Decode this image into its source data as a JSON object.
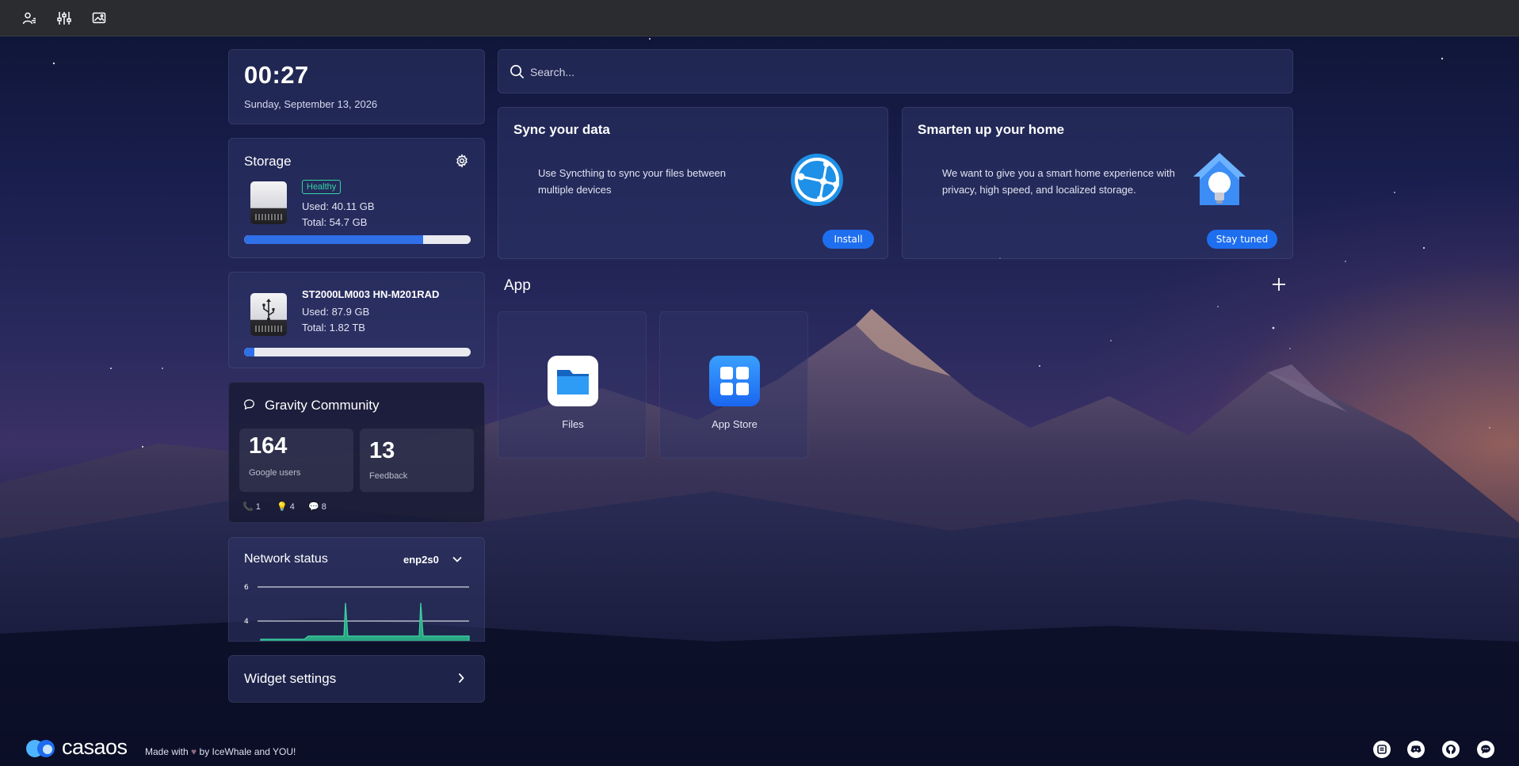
{
  "topbar": {
    "icons": [
      "account-settings-icon",
      "controls-sliders-icon",
      "wallpaper-icon"
    ]
  },
  "clock": {
    "time": "00:27",
    "date": "Sunday, September 13, 2026"
  },
  "storage": {
    "title": "Storage",
    "status": "Healthy",
    "used": "Used: 40.11 GB",
    "total": "Total: 54.7 GB",
    "used_fraction": 0.79
  },
  "usb_drive": {
    "name": "ST2000LM003 HN-M201RAD",
    "used": "Used: 87.9 GB",
    "total": "Total: 1.82 TB",
    "used_fraction": 0.047
  },
  "community": {
    "title": "Gravity Community",
    "stat1_value": "164",
    "stat1_label": "Google users",
    "stat2_value": "13",
    "stat2_label": "Feedback",
    "mini_stats": [
      "1",
      "4",
      "8"
    ]
  },
  "network": {
    "title": "Network status",
    "interface": "enp2s0",
    "y_ticks": [
      "6",
      "4"
    ]
  },
  "widget_settings": {
    "label": "Widget settings"
  },
  "search": {
    "placeholder": "Search..."
  },
  "promos": [
    {
      "title": "Sync your data",
      "description": "Use Syncthing to sync your files between multiple devices",
      "button": "Install"
    },
    {
      "title": "Smarten up your home",
      "description": "We want to give you a smart home experience with privacy, high speed, and localized storage.",
      "button": "Stay tuned"
    }
  ],
  "apps": {
    "section_title": "App",
    "items": [
      {
        "label": "Files",
        "icon": "folder-icon"
      },
      {
        "label": "App Store",
        "icon": "app-store-grid-icon"
      }
    ]
  },
  "footer": {
    "brand": "casaos",
    "made_with_prefix": "Made with",
    "made_with_suffix": "by IceWhale and YOU!",
    "icons": [
      "feedback-icon",
      "discord-icon",
      "github-icon",
      "chat-icon"
    ]
  },
  "colors": {
    "accent": "#1e6ef0",
    "healthy": "#35d3a4",
    "topbar": "#2b2c30"
  }
}
